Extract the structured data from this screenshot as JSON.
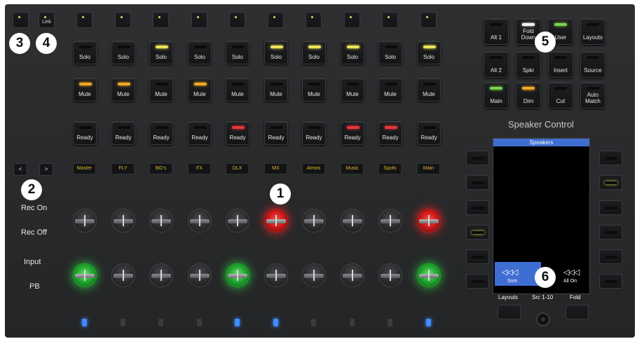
{
  "top_left": {
    "btn3_label": "",
    "btn4_label": "Link"
  },
  "channels": [
    {
      "name": "Master",
      "solo": "Solo",
      "solo_led": "off",
      "mute": "Mute",
      "mute_led": "orange",
      "ready": "Ready",
      "ready_led": "off",
      "knob_rec": "off",
      "knob_in": "green",
      "bottom_led": "on"
    },
    {
      "name": "FLY",
      "solo": "Solo",
      "solo_led": "off",
      "mute": "Mute",
      "mute_led": "orange",
      "ready": "Ready",
      "ready_led": "off",
      "knob_rec": "off",
      "knob_in": "off",
      "bottom_led": "off"
    },
    {
      "name": "BG's",
      "solo": "Solo",
      "solo_led": "yellow",
      "mute": "Mute",
      "mute_led": "off",
      "ready": "Ready",
      "ready_led": "off",
      "knob_rec": "off",
      "knob_in": "off",
      "bottom_led": "off"
    },
    {
      "name": "FX",
      "solo": "Solo",
      "solo_led": "off",
      "mute": "Mute",
      "mute_led": "orange",
      "ready": "Ready",
      "ready_led": "off",
      "knob_rec": "off",
      "knob_in": "off",
      "bottom_led": "off"
    },
    {
      "name": "DLX",
      "solo": "Solo",
      "solo_led": "off",
      "mute": "Mute",
      "mute_led": "off",
      "ready": "Ready",
      "ready_led": "red",
      "knob_rec": "off",
      "knob_in": "green",
      "bottom_led": "on"
    },
    {
      "name": "MX",
      "solo": "Solo",
      "solo_led": "yellow",
      "mute": "Mute",
      "mute_led": "off",
      "ready": "Ready",
      "ready_led": "off",
      "knob_rec": "red",
      "knob_in": "off",
      "bottom_led": "on"
    },
    {
      "name": "Atmos",
      "solo": "Solo",
      "solo_led": "yellow",
      "mute": "Mute",
      "mute_led": "off",
      "ready": "Ready",
      "ready_led": "off",
      "knob_rec": "off",
      "knob_in": "off",
      "bottom_led": "off"
    },
    {
      "name": "Music",
      "solo": "Solo",
      "solo_led": "yellow",
      "mute": "Mute",
      "mute_led": "off",
      "ready": "Ready",
      "ready_led": "red",
      "knob_rec": "off",
      "knob_in": "off",
      "bottom_led": "off"
    },
    {
      "name": "Spots",
      "solo": "Solo",
      "solo_led": "off",
      "mute": "Mute",
      "mute_led": "off",
      "ready": "Ready",
      "ready_led": "red",
      "knob_rec": "off",
      "knob_in": "off",
      "bottom_led": "off"
    },
    {
      "name": "Main",
      "solo": "Solo",
      "solo_led": "yellow",
      "mute": "Mute",
      "mute_led": "off",
      "ready": "Ready",
      "ready_led": "off",
      "knob_rec": "red",
      "knob_in": "green",
      "bottom_led": "on"
    }
  ],
  "nav": {
    "left": "<",
    "right": ">"
  },
  "row_labels": {
    "rec_on": "Rec On",
    "rec_off": "Rec Off",
    "input": "Input",
    "pb": "PB"
  },
  "badges": {
    "b1": "1",
    "b2": "2",
    "b3": "3",
    "b4": "4",
    "b5": "5",
    "b6": "6"
  },
  "speaker_control": {
    "title": "Speaker Control",
    "buttons": [
      {
        "label": "Alt 1",
        "led": "off"
      },
      {
        "label": "Fold Down",
        "led": "white"
      },
      {
        "label": "User",
        "led": "green"
      },
      {
        "label": "Layouts",
        "led": "off"
      },
      {
        "label": "Alt 2",
        "led": "off"
      },
      {
        "label": "Spkr",
        "led": "off"
      },
      {
        "label": "Insert",
        "led": "off"
      },
      {
        "label": "Source",
        "led": "off"
      },
      {
        "label": "Main",
        "led": "green"
      },
      {
        "label": "Dim",
        "led": "orange"
      },
      {
        "label": "Cut",
        "led": "off"
      },
      {
        "label": "Auto Match",
        "led": "off"
      }
    ]
  },
  "screen": {
    "title": "Speakers",
    "sum_label": "Sum",
    "allon_label": "All On",
    "bottom": {
      "left": "Layouts",
      "mid": "Src 1-10",
      "right": "Fold"
    }
  },
  "side_buttons": {
    "left_leds": [
      "off",
      "off",
      "off",
      "yellow",
      "off",
      "off"
    ],
    "right_leds": [
      "off",
      "yellow",
      "off",
      "off",
      "off",
      "off"
    ]
  },
  "colors": {
    "accent_blue": "#3f6ed3",
    "yellow": "#ece35a",
    "orange": "#f2a826",
    "red": "#e8343a",
    "green": "#7bd24c"
  }
}
